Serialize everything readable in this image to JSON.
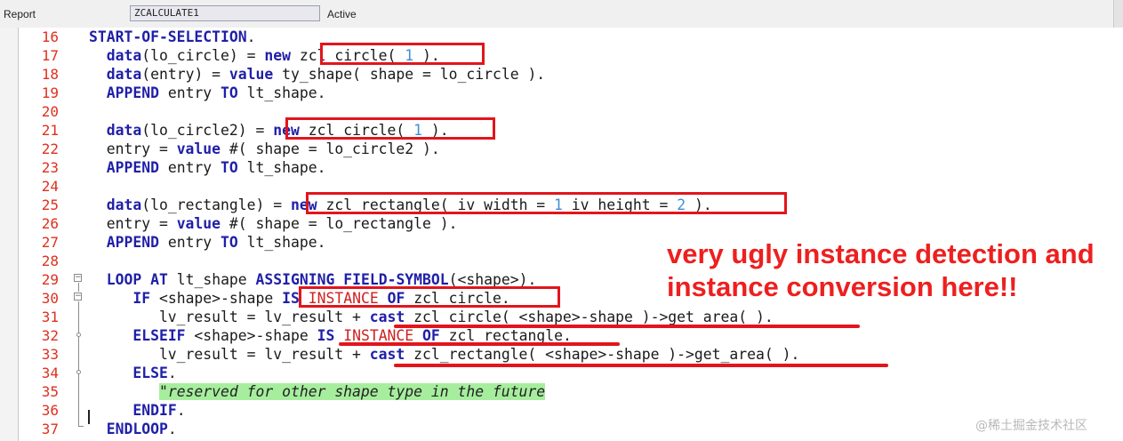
{
  "header": {
    "type_label": "Report",
    "program_name": "ZCALCULATE1",
    "status": "Active"
  },
  "colors": {
    "line_numbers": "#e0301e",
    "keywords": "#1f1fa8",
    "numbers": "#3c8fd6",
    "highlight_box": "#e2151c",
    "comment_bg": "#a6ee9e",
    "annotation": "#ee1f1f"
  },
  "lines": [
    {
      "num": "16",
      "code": "START-OF-SELECTION."
    },
    {
      "num": "17",
      "code": "  data(lo_circle) = new zcl_circle( 1 )."
    },
    {
      "num": "18",
      "code": "  data(entry) = value ty_shape( shape = lo_circle )."
    },
    {
      "num": "19",
      "code": "  APPEND entry TO lt_shape."
    },
    {
      "num": "20",
      "code": ""
    },
    {
      "num": "21",
      "code": "  data(lo_circle2) = new zcl_circle( 1 )."
    },
    {
      "num": "22",
      "code": "  entry = value #( shape = lo_circle2 )."
    },
    {
      "num": "23",
      "code": "  APPEND entry TO lt_shape."
    },
    {
      "num": "24",
      "code": ""
    },
    {
      "num": "25",
      "code": "  data(lo_rectangle) = new zcl_rectangle( iv_width = 1 iv_height = 2 )."
    },
    {
      "num": "26",
      "code": "  entry = value #( shape = lo_rectangle )."
    },
    {
      "num": "27",
      "code": "  APPEND entry TO lt_shape."
    },
    {
      "num": "28",
      "code": ""
    },
    {
      "num": "29",
      "code": "  LOOP AT lt_shape ASSIGNING FIELD-SYMBOL(<shape>)."
    },
    {
      "num": "30",
      "code": "     IF <shape>-shape IS INSTANCE OF zcl_circle."
    },
    {
      "num": "31",
      "code": "        lv_result = lv_result + cast zcl_circle( <shape>-shape )->get_area( )."
    },
    {
      "num": "32",
      "code": "     ELSEIF <shape>-shape IS INSTANCE OF zcl_rectangle."
    },
    {
      "num": "33",
      "code": "        lv_result = lv_result + cast zcl_rectangle( <shape>-shape )->get_area( )."
    },
    {
      "num": "34",
      "code": "     ELSE."
    },
    {
      "num": "35",
      "code": "        \"reserved for other shape type in the future"
    },
    {
      "num": "36",
      "code": "     ENDIF."
    },
    {
      "num": "37",
      "code": "  ENDLOOP."
    }
  ],
  "annotation": {
    "line1": "very ugly instance detection and",
    "line2": "instance conversion here!!"
  },
  "watermark": "@稀土掘金技术社区"
}
